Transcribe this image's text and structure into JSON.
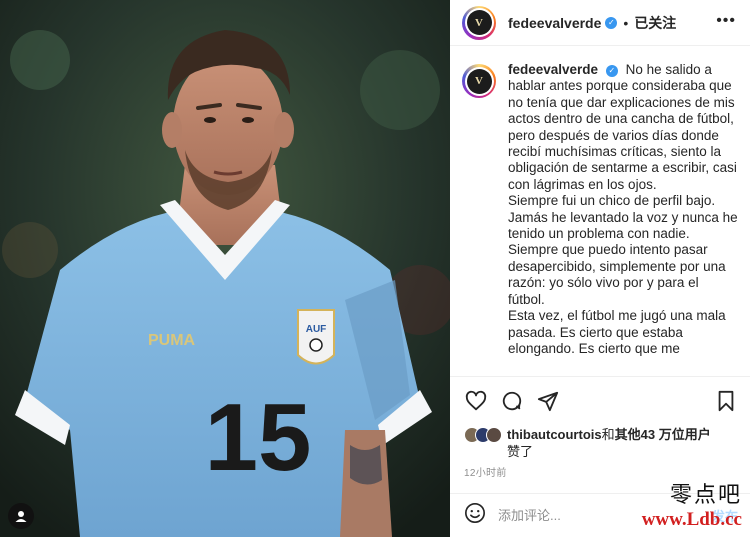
{
  "post": {
    "username": "fedeevalverde",
    "verified": true,
    "separator": "•",
    "follow_status": "已关注",
    "more_label": "•••",
    "avatar_initial": "V"
  },
  "caption": {
    "username": "fedeevalverde",
    "paragraphs": [
      "No he salido a hablar antes porque consideraba que no tenía que dar explicaciones de mis actos dentro de una cancha de fútbol, pero después de varios días donde recibí muchísimas críticas, siento la obligación de sentarme a escribir, casi con lágrimas en los ojos.",
      "Siempre fui un chico de perfil bajo. Jamás he levantado la voz y nunca he tenido un problema con nadie. Siempre que puedo intento pasar desapercibido, simplemente por una razón: yo sólo vivo por y para el fútbol.",
      "Esta vez, el fútbol me jugó una mala pasada. Es cierto que estaba elongando. Es cierto que me"
    ]
  },
  "photo": {
    "jersey_number": "15",
    "brand": "PUMA",
    "crest_text": "AUF"
  },
  "likes": {
    "liker": "thibautcourtois",
    "text_mid": "和",
    "others": "其他43 万位用户",
    "text_end": "赞了"
  },
  "timestamp": "12小时前",
  "comment": {
    "placeholder": "添加评论...",
    "post_label": "发布"
  },
  "icons": [
    "heart-icon",
    "comment-icon",
    "share-icon",
    "bookmark-icon",
    "emoji-icon",
    "user-tag-icon",
    "verified-badge-icon"
  ],
  "watermark": {
    "text": "零点吧",
    "url": "www.Ldb.cc"
  },
  "colors": {
    "accent": "#3897f0",
    "jersey": "#7fb5df",
    "watermark_url": "#d21f1f",
    "post_button": "#b3dbff"
  }
}
